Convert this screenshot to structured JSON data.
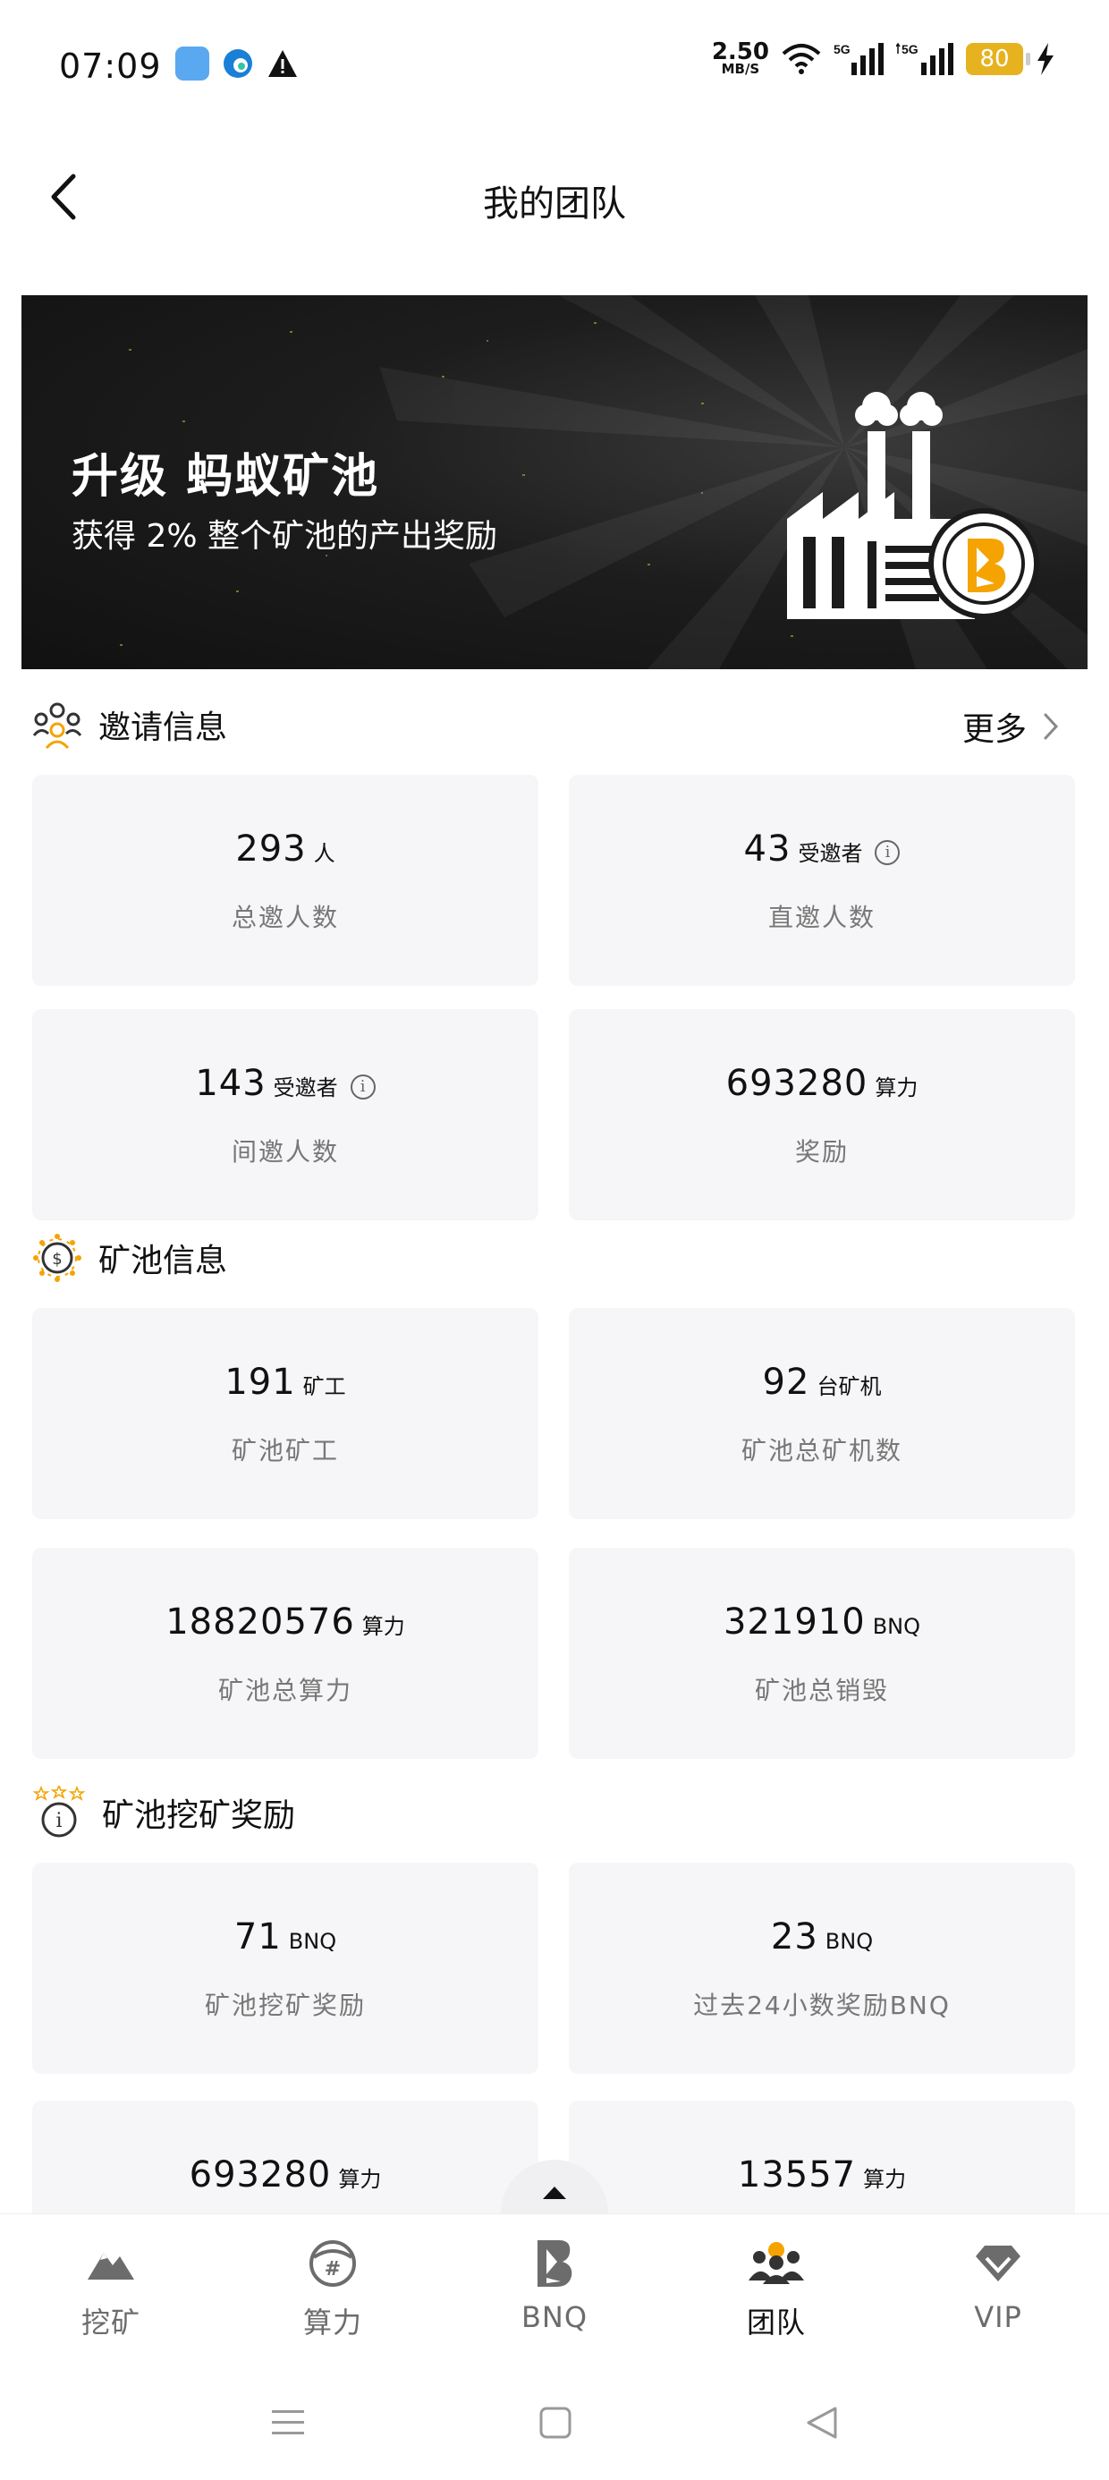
{
  "status_bar": {
    "time": "07:09",
    "speed_value": "2.50",
    "speed_unit": "MB/S",
    "network_1": "5G",
    "network_2": "5G",
    "battery": "80"
  },
  "header": {
    "title": "我的团队"
  },
  "banner": {
    "title": "升级  蚂蚁矿池",
    "subtitle": "获得 2% 整个矿池的产出奖励"
  },
  "invite_section": {
    "title": "邀请信息",
    "more": "更多",
    "cards": [
      {
        "value": "293",
        "unit": "人",
        "label": "总邀人数"
      },
      {
        "value": "43",
        "unit": "受邀者",
        "label": "直邀人数"
      },
      {
        "value": "143",
        "unit": "受邀者",
        "label": "间邀人数"
      },
      {
        "value": "693280",
        "unit": "算力",
        "label": "奖励"
      }
    ]
  },
  "pool_section": {
    "title": "矿池信息",
    "cards": [
      {
        "value": "191",
        "unit": "矿工",
        "label": "矿池矿工"
      },
      {
        "value": "92",
        "unit": "台矿机",
        "label": "矿池总矿机数"
      },
      {
        "value": "18820576",
        "unit": "算力",
        "label": "矿池总算力"
      },
      {
        "value": "321910",
        "unit": "BNQ",
        "label": "矿池总销毁"
      }
    ]
  },
  "reward_section": {
    "title": "矿池挖矿奖励",
    "cards": [
      {
        "value": "71",
        "unit": "BNQ",
        "label": "矿池挖矿奖励"
      },
      {
        "value": "23",
        "unit": "BNQ",
        "label": "过去24小数奖励BNQ"
      },
      {
        "value": "693280",
        "unit": "算力",
        "label": ""
      },
      {
        "value": "13557",
        "unit": "算力",
        "label": ""
      }
    ]
  },
  "bottom_nav": [
    {
      "label": "挖矿",
      "icon": "mountain-icon"
    },
    {
      "label": "算力",
      "icon": "hashrate-icon"
    },
    {
      "label": "BNQ",
      "icon": "bnq-logo-icon"
    },
    {
      "label": "团队",
      "icon": "team-icon",
      "active": true
    },
    {
      "label": "VIP",
      "icon": "vip-diamond-icon"
    }
  ],
  "colors": {
    "accent": "#f5a300",
    "card_bg": "#f6f6f8",
    "banner_bg": "#1a1a1a"
  }
}
